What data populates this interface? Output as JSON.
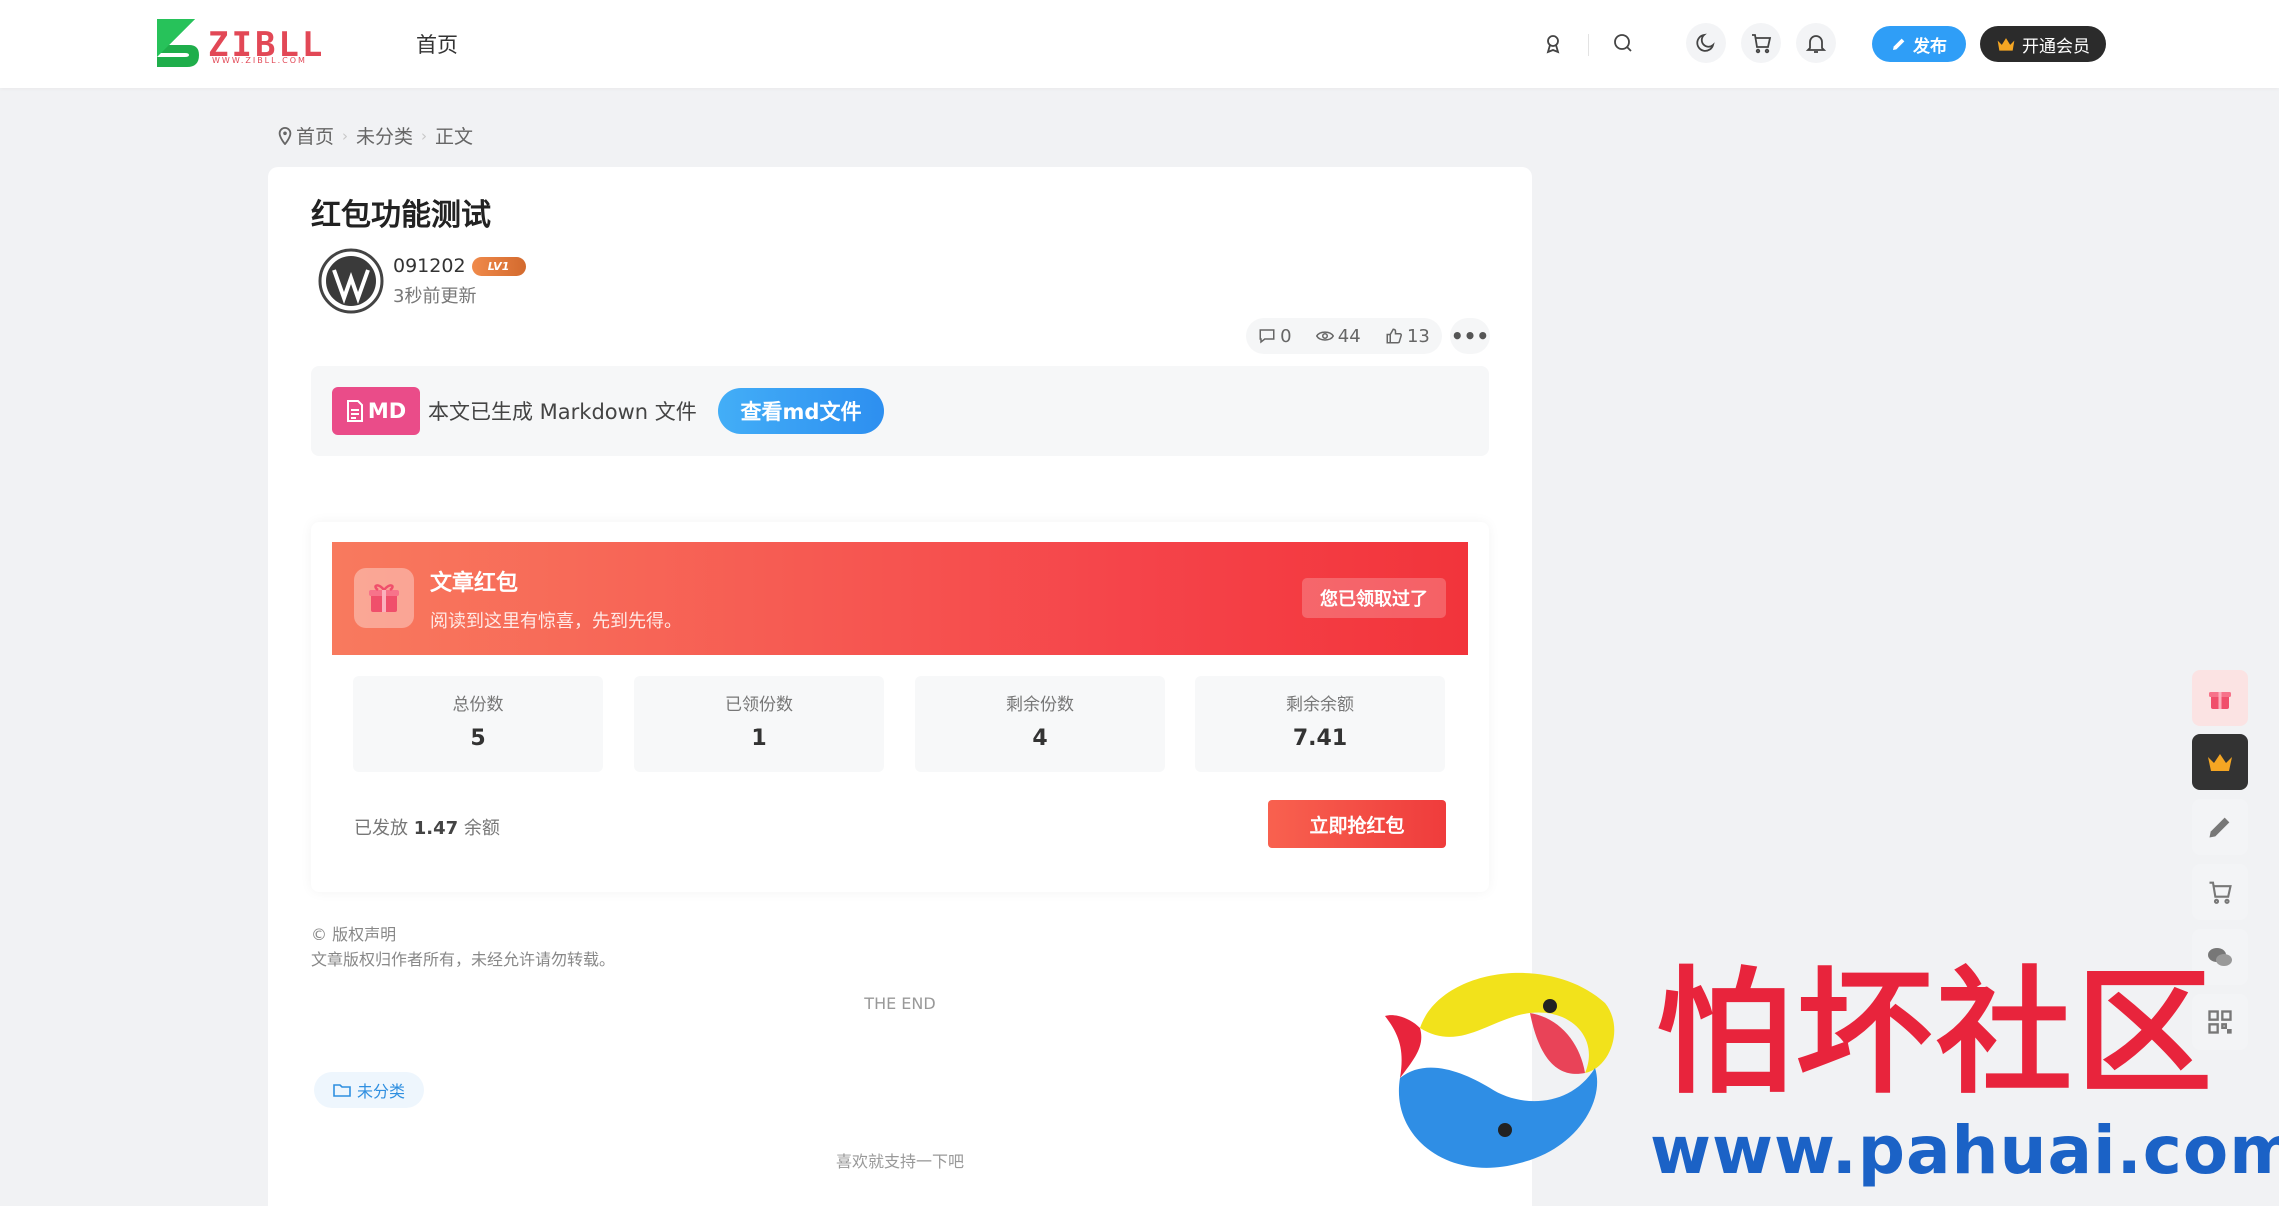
{
  "header": {
    "logo_text": "ZIBLL",
    "logo_sub": "WWW.ZIBLL.COM",
    "nav_home": "首页",
    "publish_label": "发布",
    "vip_label": "开通会员"
  },
  "breadcrumb": {
    "home": "首页",
    "category": "未分类",
    "current": "正文"
  },
  "article": {
    "title": "红包功能测试",
    "author": "091202",
    "level": "LV1",
    "updated": "3秒前更新",
    "comments": "0",
    "views": "44",
    "likes": "13"
  },
  "markdown": {
    "badge": "MD",
    "text": "本文已生成 Markdown 文件",
    "button": "查看md文件"
  },
  "red_packet": {
    "title": "文章红包",
    "subtitle": "阅读到这里有惊喜，先到先得。",
    "claimed_label": "您已领取过了",
    "stats": [
      {
        "label": "总份数",
        "value": "5"
      },
      {
        "label": "已领份数",
        "value": "1"
      },
      {
        "label": "剩余份数",
        "value": "4"
      },
      {
        "label": "剩余余额",
        "value": "7.41"
      }
    ],
    "dist_prefix": "已发放",
    "dist_amount": "1.47",
    "dist_suffix": "余额",
    "grab_label": "立即抢红包"
  },
  "footer": {
    "copyright_head": "© 版权声明",
    "copyright_body": "文章版权归作者所有，未经允许请勿转载。",
    "the_end": "THE END",
    "tag": "未分类",
    "support": "喜欢就支持一下吧"
  },
  "watermark": {
    "name": "怕坏社区",
    "url": "www.pahuai.com"
  },
  "colors": {
    "accent_blue": "#2f9ef7",
    "red": "#f5444a",
    "md_pink": "#ea4c89",
    "logo_green": "#1fae4b",
    "logo_red": "#e24856"
  },
  "icons": [
    "locate-icon",
    "search-icon",
    "moon-icon",
    "cart-icon",
    "bell-icon",
    "pencil-icon",
    "crown-icon",
    "pin-icon",
    "comment-icon",
    "eye-icon",
    "thumb-up-icon",
    "more-icon",
    "file-icon",
    "gift-icon",
    "folder-icon",
    "wechat-icon",
    "qrcode-icon"
  ]
}
